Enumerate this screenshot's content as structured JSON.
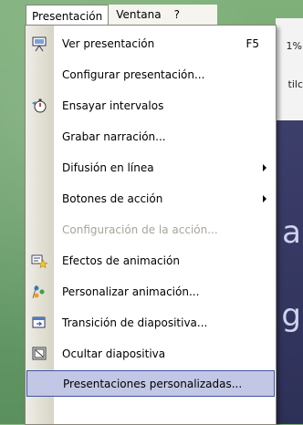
{
  "menubar": {
    "presentation": "Presentación",
    "window": "Ventana",
    "help": "?"
  },
  "slide": {
    "top_right_percent": "1%",
    "top_right_text": "tilc",
    "letter_a": "a",
    "letter_g": "g"
  },
  "menu": {
    "items": [
      {
        "label": "Ver presentación",
        "shortcut": "F5",
        "icon": "projector-screen-icon"
      },
      {
        "label": "Configurar presentación...",
        "icon": ""
      },
      {
        "label": "Ensayar intervalos",
        "icon": "stopwatch-icon"
      },
      {
        "label": "Grabar narración...",
        "icon": ""
      },
      {
        "label": "Difusión en línea",
        "icon": "",
        "submenu": true
      },
      {
        "label": "Botones de acción",
        "icon": "",
        "submenu": true
      },
      {
        "label": "Configuración de la acción...",
        "icon": "",
        "disabled": true
      },
      {
        "label": "Efectos de animación",
        "icon": "animation-star-icon"
      },
      {
        "label": "Personalizar animación...",
        "icon": "custom-animation-icon"
      },
      {
        "label": "Transición de diapositiva...",
        "icon": "slide-transition-icon"
      },
      {
        "label": "Ocultar diapositiva",
        "icon": "hide-slide-icon"
      },
      {
        "label": "Presentaciones personalizadas...",
        "icon": "",
        "highlighted": true
      }
    ]
  },
  "colors": {
    "highlight_bg": "#c1c7e4",
    "highlight_border": "#3f54a5",
    "disabled_text": "#a8a49a"
  }
}
